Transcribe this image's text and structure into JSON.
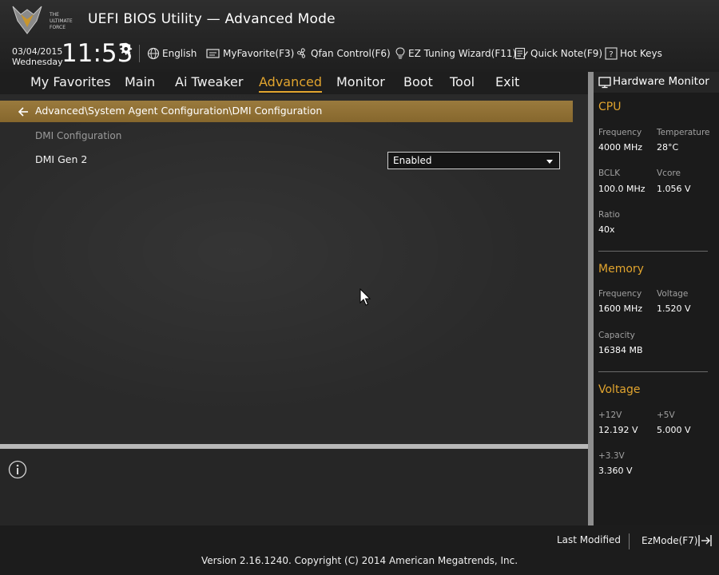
{
  "header": {
    "logo_text": [
      "THE",
      "ULTIMATE",
      "FORCE"
    ],
    "title": "UEFI BIOS Utility — Advanced Mode",
    "date": "03/04/2015",
    "weekday": "Wednesday",
    "time": "11:53",
    "tools": {
      "language": "English",
      "myfavorite": "MyFavorite(F3)",
      "qfan": "Qfan Control(F6)",
      "ez_tuning": "EZ Tuning Wizard(F11)",
      "quick_note": "Quick Note(F9)",
      "hot_keys": "Hot Keys"
    }
  },
  "nav": {
    "items": [
      "My Favorites",
      "Main",
      "Ai Tweaker",
      "Advanced",
      "Monitor",
      "Boot",
      "Tool",
      "Exit"
    ],
    "active": "Advanced"
  },
  "main": {
    "breadcrumb": "Advanced\\System Agent Configuration\\DMI Configuration",
    "section_label": "DMI Configuration",
    "settings": [
      {
        "label": "DMI Gen 2",
        "value": "Enabled"
      }
    ]
  },
  "hardware_monitor": {
    "title": "Hardware Monitor",
    "cpu": {
      "title": "CPU",
      "frequency_label": "Frequency",
      "frequency": "4000 MHz",
      "temperature_label": "Temperature",
      "temperature": "28°C",
      "bclk_label": "BCLK",
      "bclk": "100.0 MHz",
      "vcore_label": "Vcore",
      "vcore": "1.056 V",
      "ratio_label": "Ratio",
      "ratio": "40x"
    },
    "memory": {
      "title": "Memory",
      "frequency_label": "Frequency",
      "frequency": "1600 MHz",
      "voltage_label": "Voltage",
      "voltage": "1.520 V",
      "capacity_label": "Capacity",
      "capacity": "16384 MB"
    },
    "voltage": {
      "title": "Voltage",
      "v12_label": "+12V",
      "v12": "12.192 V",
      "v5_label": "+5V",
      "v5": "5.000 V",
      "v33_label": "+3.3V",
      "v33": "3.360 V"
    }
  },
  "footer": {
    "last_modified": "Last Modified",
    "ezmode": "EzMode(F7)",
    "version": "Version 2.16.1240. Copyright (C) 2014 American Megatrends, Inc."
  },
  "colors": {
    "accent": "#e1a42e",
    "breadcrumb_bar": "#8c6c30",
    "background": "#262626"
  },
  "icons": [
    "gear-icon",
    "globe-icon",
    "favorite-icon",
    "fan-icon",
    "bulb-icon",
    "note-icon",
    "help-icon",
    "back-arrow-icon",
    "info-icon",
    "monitor-icon",
    "exit-icon",
    "mouse-pointer-icon"
  ]
}
